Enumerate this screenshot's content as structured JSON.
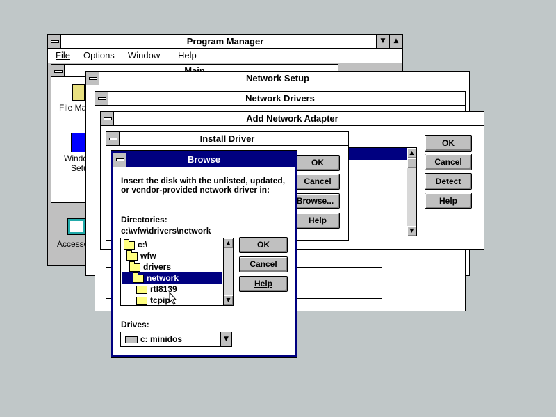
{
  "program_manager": {
    "title": "Program Manager",
    "menu": [
      "File",
      "Options",
      "Window",
      "Help"
    ],
    "main_group_title": "Main",
    "icons": {
      "file_manager": "File Man",
      "windows_setup_1": "Windo",
      "windows_setup_2": "Setu",
      "accessories": "Accesso"
    }
  },
  "network_setup": {
    "title": "Network Setup"
  },
  "network_drivers": {
    "title": "Network Drivers"
  },
  "add_network_adapter": {
    "title": "Add Network Adapter",
    "buttons": {
      "ok": "OK",
      "cancel": "Cancel",
      "detect": "Detect",
      "help": "Help"
    }
  },
  "install_driver": {
    "title": "Install Driver",
    "buttons": {
      "ok": "OK",
      "cancel": "Cancel",
      "browse": "Browse...",
      "help": "Help"
    }
  },
  "browse": {
    "title": "Browse",
    "instruction_line1": "Insert the disk with the unlisted, updated,",
    "instruction_line2": "or vendor-provided network driver in:",
    "directories_label": "Directories:",
    "current_path": "c:\\wfw\\drivers\\network",
    "directories": [
      "c:\\",
      "wfw",
      "drivers",
      "network",
      "rtl8139",
      "tcpip"
    ],
    "selected_directory": "network",
    "drives_label": "Drives:",
    "drive_value": "c: minidos",
    "buttons": {
      "ok": "OK",
      "cancel": "Cancel",
      "help": "Help"
    }
  }
}
